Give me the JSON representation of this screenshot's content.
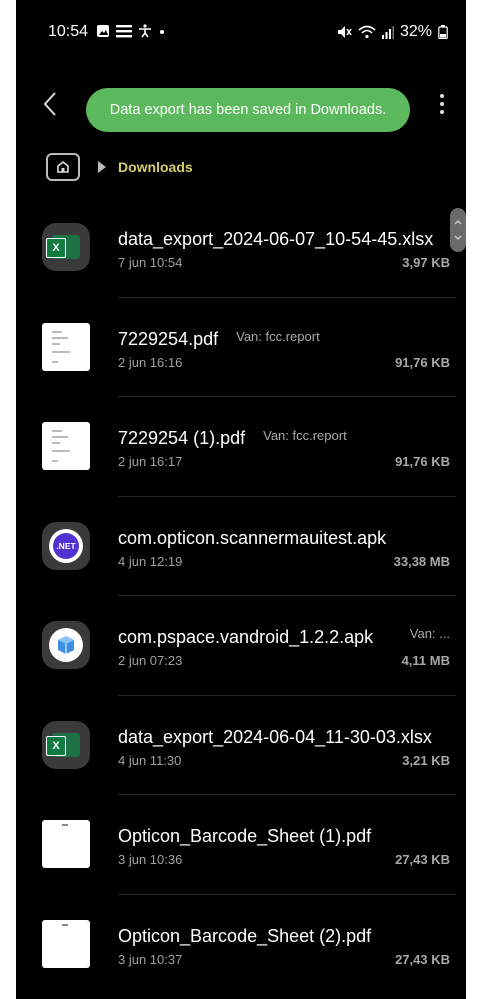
{
  "status_bar": {
    "time": "10:54",
    "battery": "32%"
  },
  "toast": {
    "text": "Data export has been saved in Downloads."
  },
  "breadcrumb": {
    "current": "Downloads"
  },
  "files": [
    {
      "name": "data_export_2024-06-07_10-54-45.xlsx",
      "source": "",
      "date": "7 jun 10:54",
      "size": "3,97 KB",
      "icon": "excel"
    },
    {
      "name": "7229254.pdf",
      "source": "Van: fcc.report",
      "date": "2 jun 16:16",
      "size": "91,76 KB",
      "icon": "pdf"
    },
    {
      "name": "7229254 (1).pdf",
      "source": "Van: fcc.report",
      "date": "2 jun 16:17",
      "size": "91,76 KB",
      "icon": "pdf"
    },
    {
      "name": "com.opticon.scannermauitest.apk",
      "source": "",
      "date": "4 jun 12:19",
      "size": "33,38 MB",
      "icon": "dotnet"
    },
    {
      "name": "com.pspace.vandroid_1.2.2.apk",
      "source": "Van: ...",
      "date": "2 jun 07:23",
      "size": "4,11 MB",
      "icon": "package"
    },
    {
      "name": "data_export_2024-06-04_11-30-03.xlsx",
      "source": "",
      "date": "4 jun 11:30",
      "size": "3,21 KB",
      "icon": "excel"
    },
    {
      "name": "Opticon_Barcode_Sheet (1).pdf",
      "source": "",
      "date": "3 jun 10:36",
      "size": "27,43 KB",
      "icon": "pdf-blank"
    },
    {
      "name": "Opticon_Barcode_Sheet (2).pdf",
      "source": "",
      "date": "3 jun 10:37",
      "size": "27,43 KB",
      "icon": "pdf-blank"
    }
  ]
}
